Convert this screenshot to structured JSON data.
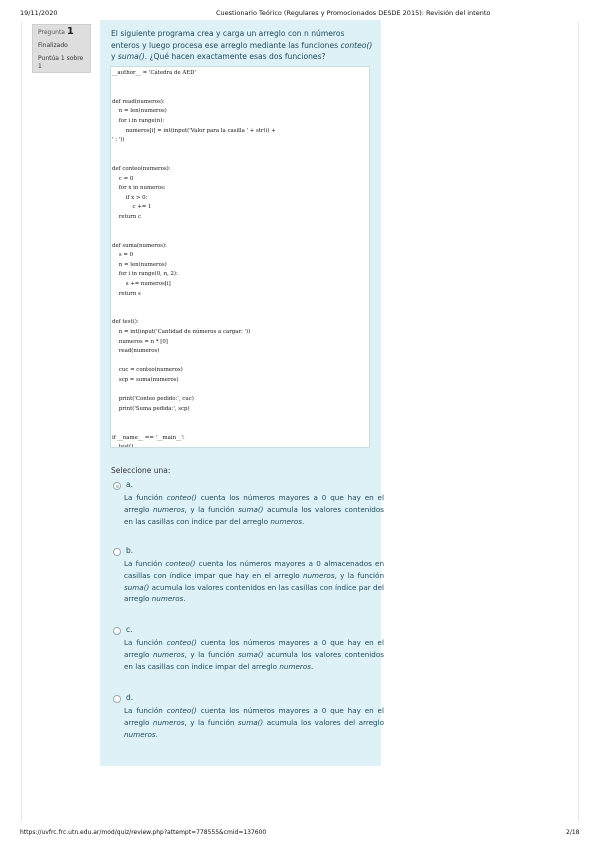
{
  "header": {
    "date": "19/11/2020",
    "title": "Cuestionario Teórico (Regulares y Promocionados DESDE 2015): Revisión del intento"
  },
  "info": {
    "question_label": "Pregunta",
    "question_number": "1",
    "status": "Finalizado",
    "score": "Puntúa 1 sobre 1"
  },
  "question": {
    "text_before": "El siguiente programa crea y carga un arreglo con n números enteros y luego procesa ese arreglo mediante las funciones ",
    "func1": "conteo()",
    "mid": " y ",
    "func2": "suma()",
    "text_after": ". ¿Qué hacen exactamente esas dos funciones?"
  },
  "code_lines": [
    "__author__ = 'Cátedra de AED'",
    "",
    "",
    "def read(numeros):",
    "    n = len(numeros)",
    "    for i in range(n):",
    "        numeros[i] = int(input('Valor para la casilla ' + str(i) +",
    "' : '))",
    "",
    "",
    "def conteo(numeros):",
    "    c = 0",
    "    for x in numeros:",
    "        if x > 0:",
    "            c += 1",
    "    return c",
    "",
    "",
    "def suma(numeros):",
    "    s = 0",
    "    n = len(numeros)",
    "    for i in range(0, n, 2):",
    "        s += numeros[i]",
    "    return s",
    "",
    "",
    "def test():",
    "    n = int(input('Cantidad de números a cargar: '))",
    "    numeros = n * [0]",
    "    read(numeros)",
    "",
    "    cuc = conteo(numeros)",
    "    scp = suma(numeros)",
    "",
    "    print('Conteo pedido:', cuc)",
    "    print('Suma pedida:', scp)",
    "",
    "",
    "if __name__ == '__main__':",
    "    test()"
  ],
  "select_label": "Seleccione una:",
  "options": [
    {
      "letter": "a.",
      "p1": "La función ",
      "f1": "conteo()",
      "p2": " cuenta los números mayores a 0 que hay en el arreglo ",
      "f2": "numeros",
      "p3": ", y la función ",
      "f3": "suma()",
      "p4": " acumula los valores contenidos en las casillas con índice par del arreglo ",
      "f4": "numeros",
      "p5": ".",
      "checked": true
    },
    {
      "letter": "b.",
      "p1": "La función ",
      "f1": "conteo()",
      "p2": " cuenta los números mayores a 0 almacenados en casillas con índice impar que hay en el arreglo ",
      "f2": "numeros",
      "p3": ", y la función ",
      "f3": "suma()",
      "p4": " acumula los valores contenidos en las casillas con índice par del arreglo ",
      "f4": "numeros",
      "p5": ".",
      "checked": false
    },
    {
      "letter": "c.",
      "p1": "La función ",
      "f1": "conteo()",
      "p2": " cuenta los números mayores a 0 que hay en el arreglo ",
      "f2": "numeros",
      "p3": ", y la función ",
      "f3": "suma()",
      "p4": " acumula los valores contenidos en las casillas con índice impar del arreglo ",
      "f4": "numeros",
      "p5": ".",
      "checked": false
    },
    {
      "letter": "d.",
      "p1": "La función ",
      "f1": "conteo()",
      "p2": " cuenta los números mayores a 0 que hay en el arreglo ",
      "f2": "numeros",
      "p3": ", y la función ",
      "f3": "suma()",
      "p4": " acumula los valores del arreglo ",
      "f4": "numeros",
      "p5": ".",
      "checked": false
    }
  ],
  "footer": {
    "url": "https://uvfrc.frc.utn.edu.ar/mod/quiz/review.php?attempt=778555&cmid=137600",
    "page": "2/18"
  },
  "colors": {
    "panel_bg": "#def1f7",
    "text_accent": "#1d4a5c",
    "info_bg": "#dedede"
  }
}
